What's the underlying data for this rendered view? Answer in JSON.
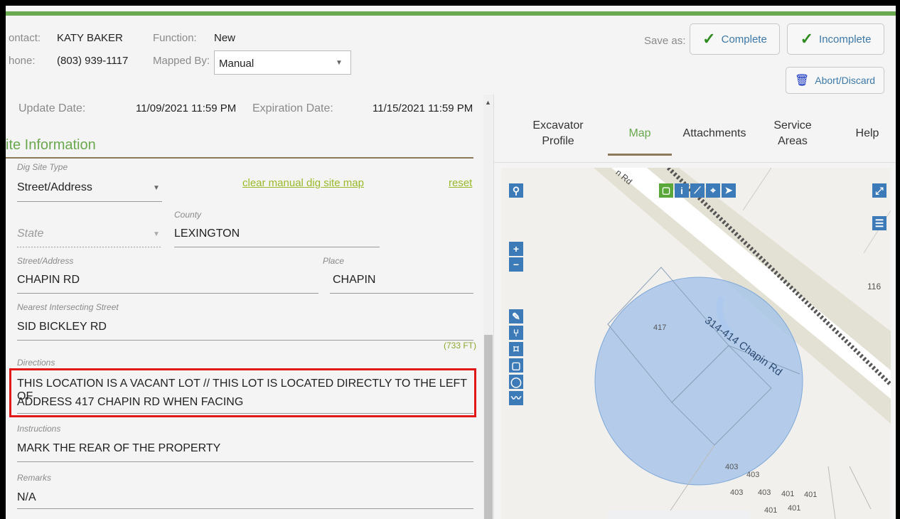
{
  "header": {
    "contact_label": "ontact:",
    "contact_value": "KATY BAKER",
    "phone_label": "hone:",
    "phone_value": "(803) 939-1117",
    "function_label": "Function:",
    "function_value": "New",
    "mapped_by_label": "Mapped By:",
    "mapped_by_value": "Manual",
    "save_as_label": "Save as:",
    "complete_label": "Complete",
    "incomplete_label": "Incomplete",
    "abort_label": "Abort/Discard"
  },
  "form": {
    "update_date_label": "Update Date:",
    "update_date_value": "11/09/2021 11:59 PM",
    "expiration_date_label": "Expiration Date:",
    "expiration_date_value": "11/15/2021 11:59 PM",
    "section_title": "ite Information",
    "dig_site_type_label": "Dig Site Type",
    "dig_site_type_value": "Street/Address",
    "clear_map_link": "clear manual dig site map",
    "reset_link": "reset",
    "county_label": "County",
    "state_placeholder": "State",
    "county_value": "LEXINGTON",
    "street_label": "Street/Address",
    "street_value": "CHAPIN RD",
    "place_label": "Place",
    "place_value": "CHAPIN",
    "intersect_label": "Nearest Intersecting Street",
    "intersect_value": "SID BICKLEY RD",
    "distance": "(733 FT)",
    "directions_label": "Directions",
    "directions_line1": "THIS LOCATION IS A VACANT LOT // THIS LOT IS LOCATED DIRECTLY TO THE LEFT OF",
    "directions_line2": "ADDRESS 417 CHAPIN RD WHEN FACING",
    "instructions_label": "Instructions",
    "instructions_value": "MARK THE REAR OF THE PROPERTY",
    "remarks_label": "Remarks",
    "remarks_value": "N/A"
  },
  "tabs": {
    "excavator_line1": "Excavator",
    "excavator_line2": "Profile",
    "map": "Map",
    "attachments": "Attachments",
    "service_line1": "Service",
    "service_line2": "Areas",
    "help": "Help"
  },
  "map": {
    "road_top": "n Rd",
    "road_label": "314-414 Chapin Rd",
    "parcel_417": "417",
    "parcel_116": "116",
    "parcel_403a": "403",
    "parcel_403b": "403",
    "parcel_403c": "403",
    "parcel_403d": "403",
    "parcel_401a": "401",
    "parcel_401b": "401",
    "parcel_401c": "401",
    "parcel_401d": "401",
    "colors": {
      "circle": "#9fc0ea",
      "accent": "#6aa84f",
      "highlight": "#e01818"
    }
  }
}
